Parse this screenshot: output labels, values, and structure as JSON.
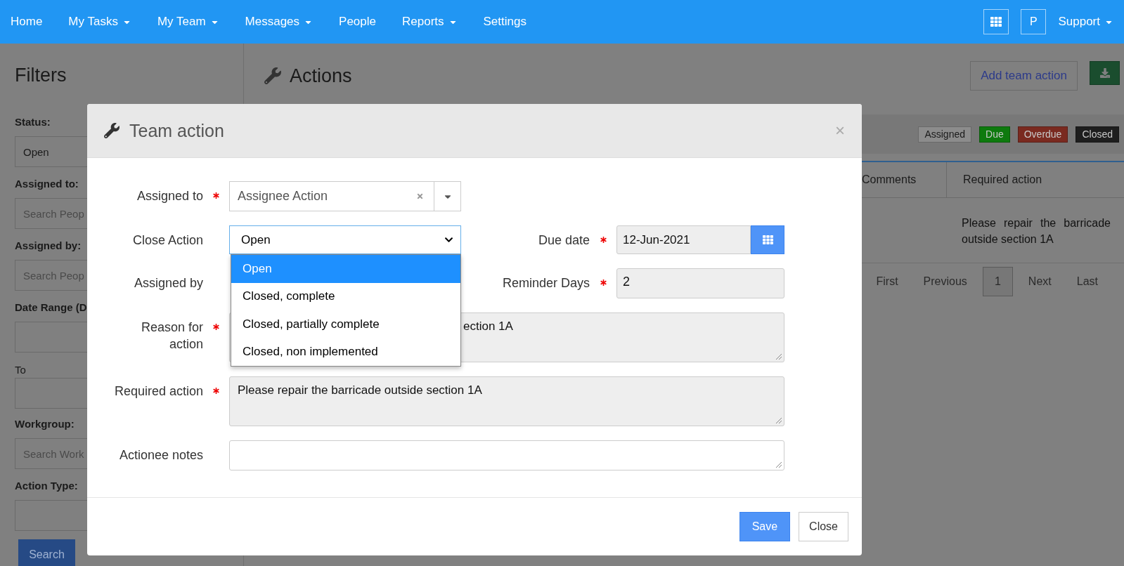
{
  "nav": {
    "items": [
      {
        "label": "Home",
        "caret": false
      },
      {
        "label": "My Tasks",
        "caret": true
      },
      {
        "label": "My Team",
        "caret": true
      },
      {
        "label": "Messages",
        "caret": true
      },
      {
        "label": "People",
        "caret": false
      },
      {
        "label": "Reports",
        "caret": true
      },
      {
        "label": "Settings",
        "caret": false
      }
    ],
    "profile": "P",
    "support": {
      "label": "Support",
      "caret": true
    }
  },
  "sidebar": {
    "title": "Filters",
    "items": [
      {
        "kind": "label",
        "text": "Status:"
      },
      {
        "kind": "field",
        "value": "Open"
      },
      {
        "kind": "label",
        "text": "Assigned to:"
      },
      {
        "kind": "field",
        "placeholder": "Search Peop"
      },
      {
        "kind": "label",
        "text": "Assigned by:"
      },
      {
        "kind": "field",
        "placeholder": "Search Peop"
      },
      {
        "kind": "label",
        "text": "Date Range (D"
      },
      {
        "kind": "field"
      },
      {
        "kind": "to",
        "text": "To"
      },
      {
        "kind": "field"
      },
      {
        "kind": "label",
        "text": "Workgroup:"
      },
      {
        "kind": "field",
        "placeholder": "Search Work"
      },
      {
        "kind": "label",
        "text": "Action Type:"
      },
      {
        "kind": "field"
      },
      {
        "kind": "button",
        "text": "Search"
      }
    ]
  },
  "main": {
    "title": "Actions",
    "add_button": "Add team action",
    "legend": [
      {
        "label": "Assigned",
        "color": "#8c8c8c"
      },
      {
        "label": "Due",
        "color": "#0e7a0e"
      },
      {
        "label": "Overdue",
        "color": "#7a2a20"
      },
      {
        "label": "Closed",
        "color": "#1e1e1e"
      }
    ],
    "table": {
      "columns": [
        "Comments",
        "Required action"
      ],
      "rows": [
        {
          "required_action": "Please repair the barricade outside section 1A"
        }
      ]
    },
    "pagination": {
      "first": "First",
      "previous": "Previous",
      "pages": [
        {
          "label": "1",
          "selected": true
        }
      ],
      "next": "Next",
      "last": "Last"
    }
  },
  "modal": {
    "title": "Team action",
    "close": "×",
    "rows": [
      [
        {
          "kind": "combo",
          "label": "Assigned to",
          "required": true,
          "value": "Assignee Action"
        }
      ],
      [
        {
          "kind": "select",
          "label": "Close Action",
          "required": false,
          "value": "Open",
          "expanded": true
        },
        {
          "kind": "date",
          "label": "Due date",
          "required": true,
          "value": "12-Jun-2021"
        }
      ],
      [
        {
          "kind": "covered",
          "label": "Assigned by",
          "required": false
        },
        {
          "kind": "input",
          "label": "Reminder Days",
          "required": true,
          "value": "2"
        }
      ],
      [
        {
          "kind": "textarea",
          "label": "Reason for action",
          "required": true,
          "value": "ection 1A",
          "covered": true
        }
      ],
      [
        {
          "kind": "textarea",
          "label": "Required action",
          "required": true,
          "value": "Please repair the barricade outside section 1A",
          "covered": false
        }
      ],
      [
        {
          "kind": "note",
          "label": "Actionee notes",
          "required": false
        }
      ]
    ],
    "dropdown": {
      "options": [
        {
          "label": "Open",
          "selected": true
        },
        {
          "label": "Closed, complete",
          "selected": false
        },
        {
          "label": "Closed, partially complete",
          "selected": false
        },
        {
          "label": "Closed, non implemented",
          "selected": false
        }
      ]
    },
    "buttons": [
      {
        "label": "Save",
        "kind": "primary"
      },
      {
        "label": "Close",
        "kind": "default"
      }
    ]
  }
}
